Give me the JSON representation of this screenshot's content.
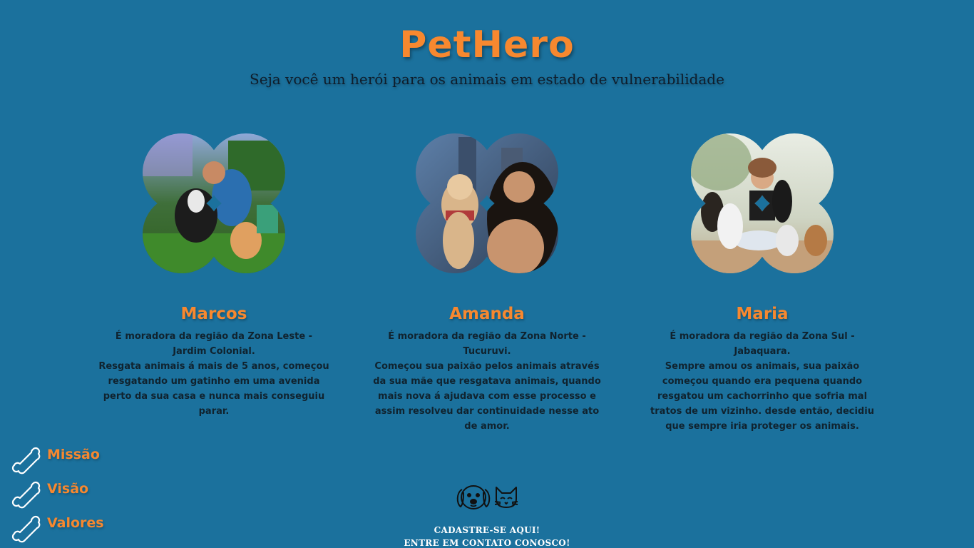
{
  "header": {
    "brand": "PetHero",
    "tagline": "Seja você um herói para os animais em estado de vulnerabilidade"
  },
  "colors": {
    "background": "#1b719d",
    "accent": "#f7882f",
    "text_dark": "#10232f",
    "white": "#ffffff"
  },
  "heroes": [
    {
      "name": "Marcos",
      "lines": [
        "É moradora da região da Zona Leste -",
        "Jardim Colonial.",
        "Resgata animais á mais de 5 anos, começou",
        "resgatando um gatinho em uma avenida",
        "perto da sua casa e nunca mais conseguiu",
        "parar."
      ]
    },
    {
      "name": "Amanda",
      "lines": [
        "É moradora da região da Zona Norte -",
        "Tucuruvi.",
        "Começou sua paixão pelos animais através",
        "da sua mãe que resgatava animais, quando",
        "mais nova á ajudava com esse processo e",
        "assim resolveu dar continuidade nesse ato",
        "de amor."
      ]
    },
    {
      "name": "Maria",
      "lines": [
        "É moradora da região da Zona Sul -",
        "Jabaquara.",
        "Sempre amou os animais, sua paixão",
        "começou quando era pequena quando",
        "resgatou um cachorrinho que sofria mal",
        "tratos de um vizinho. desde então, decidiu",
        "que sempre iria proteger os animais."
      ]
    }
  ],
  "menu": {
    "items": [
      {
        "label": "Missão",
        "icon": "bone-icon"
      },
      {
        "label": "Visão",
        "icon": "bone-icon"
      },
      {
        "label": "Valores",
        "icon": "bone-icon"
      }
    ]
  },
  "footer": {
    "icons": [
      "dog-face-icon",
      "cat-face-icon"
    ],
    "register": "CADASTRE-SE AQUI!",
    "contact": "ENTRE EM CONTATO CONOSCO!"
  }
}
